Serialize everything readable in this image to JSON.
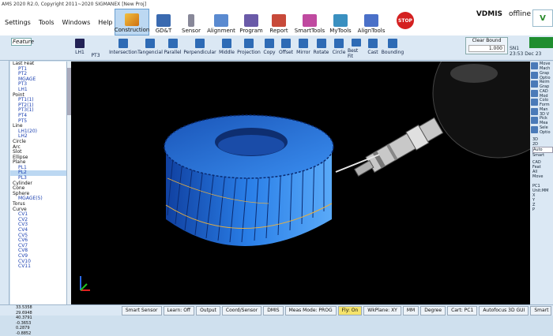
{
  "window": {
    "title": "AMS 2020 R2.0, Copyright 2011~2020 SIGMANEX [New Proj]"
  },
  "menu": [
    "Settings",
    "Tools",
    "Windows",
    "Help"
  ],
  "ribbon_tabs": [
    {
      "label": "Construction",
      "active": true,
      "icon": "construction-icon"
    },
    {
      "label": "GD&T",
      "icon": "gdt-icon"
    },
    {
      "label": "Sensor",
      "icon": "sensor-icon"
    },
    {
      "label": "Alignment",
      "icon": "alignment-icon"
    },
    {
      "label": "Program",
      "icon": "program-icon"
    },
    {
      "label": "Report",
      "icon": "report-icon"
    },
    {
      "label": "SmartTools",
      "icon": "smarttools-icon"
    },
    {
      "label": "MyTools",
      "icon": "mytools-icon"
    },
    {
      "label": "AlignTools",
      "icon": "aligntools-icon"
    }
  ],
  "stop_label": "STOP",
  "brand": {
    "name": "VDMIS",
    "status": "offline"
  },
  "feature_tab": "Feature",
  "tool_left": {
    "lh1": "LH1",
    "pt3": "PT3"
  },
  "tools": [
    "Intersection",
    "Tangencial",
    "Parallel",
    "Perpendicular",
    "Middle",
    "Projection",
    "Copy",
    "Offset",
    "Mirror",
    "Rotate",
    "Circle",
    "Best Fit",
    "Cast",
    "Bounding"
  ],
  "clear_bound": {
    "label": "Clear Bound",
    "value": "1.000"
  },
  "sn": {
    "id": "SN1",
    "time": "23:53 Dec 23"
  },
  "tree": [
    {
      "t": "h",
      "label": "Last Feat"
    },
    {
      "t": "i",
      "label": "PT1"
    },
    {
      "t": "i",
      "label": "PT2"
    },
    {
      "t": "i",
      "label": "MGAGE"
    },
    {
      "t": "i",
      "label": "PT3"
    },
    {
      "t": "i",
      "label": "LH1"
    },
    {
      "t": "h",
      "label": "Point"
    },
    {
      "t": "i",
      "label": "PT1(1)"
    },
    {
      "t": "i",
      "label": "PT2(1)"
    },
    {
      "t": "i",
      "label": "PT3(1)"
    },
    {
      "t": "i",
      "label": "PT4"
    },
    {
      "t": "i",
      "label": "PT5"
    },
    {
      "t": "h",
      "label": "Line"
    },
    {
      "t": "i",
      "label": "LH1(20)"
    },
    {
      "t": "i",
      "label": "LH2"
    },
    {
      "t": "h",
      "label": "Circle"
    },
    {
      "t": "h",
      "label": "Arc"
    },
    {
      "t": "h",
      "label": "Slot"
    },
    {
      "t": "h",
      "label": "Ellipse"
    },
    {
      "t": "h",
      "label": "Plane"
    },
    {
      "t": "i",
      "label": "PL1"
    },
    {
      "t": "i",
      "label": "PL2",
      "sel": true
    },
    {
      "t": "i",
      "label": "PL3"
    },
    {
      "t": "h",
      "label": "Cylinder"
    },
    {
      "t": "h",
      "label": "Cone"
    },
    {
      "t": "h",
      "label": "Sphere"
    },
    {
      "t": "i",
      "label": "MGAGE(5)"
    },
    {
      "t": "h",
      "label": "Torus"
    },
    {
      "t": "h",
      "label": "Curve"
    },
    {
      "t": "i",
      "label": "CV1"
    },
    {
      "t": "i",
      "label": "CV2"
    },
    {
      "t": "i",
      "label": "CV3"
    },
    {
      "t": "i",
      "label": "CV4"
    },
    {
      "t": "i",
      "label": "CV5"
    },
    {
      "t": "i",
      "label": "CV6"
    },
    {
      "t": "i",
      "label": "CV7"
    },
    {
      "t": "i",
      "label": "CV8"
    },
    {
      "t": "i",
      "label": "CV9"
    },
    {
      "t": "i",
      "label": "CV10"
    },
    {
      "t": "i",
      "label": "CV11"
    }
  ],
  "right_panel": [
    "Move Mach",
    "Grap Optio",
    "Reim Grap",
    "CAD Mod",
    "Colo Form",
    "Man 3D V",
    "Pick Mea",
    "Sele Optio"
  ],
  "right_controls": {
    "r1": "3D",
    "r2": "2D",
    "auto": "Auto",
    "smart": "Smart",
    "cad": "CAD",
    "feat": "Feat",
    "all": "All",
    "move": "Move",
    "pc": "PC1",
    "unit": "Unit:MM",
    "x": "X",
    "y": "Y",
    "z": "Z",
    "p": "P"
  },
  "coords": {
    "x": "33.5358",
    "y": "29.6948",
    "z": "40.3791",
    "i": "-0.3653",
    "j": "0.2879",
    "k": "-0.8852"
  },
  "status_buttons": [
    "Smart Sensor",
    "Learn: Off",
    "Output",
    "Coord/Sensor",
    "DMIS",
    "Meas Mode: PROG",
    "Fly: On",
    "WkPlane: XY",
    "MM",
    "Degree",
    "Cart: PC1",
    "Autofocus 3D GUI",
    "Smart Navigation"
  ],
  "colors": {
    "gear": "#2a7fe8",
    "viewport": "#000000",
    "ribbon_active": "#bcd8f2"
  }
}
